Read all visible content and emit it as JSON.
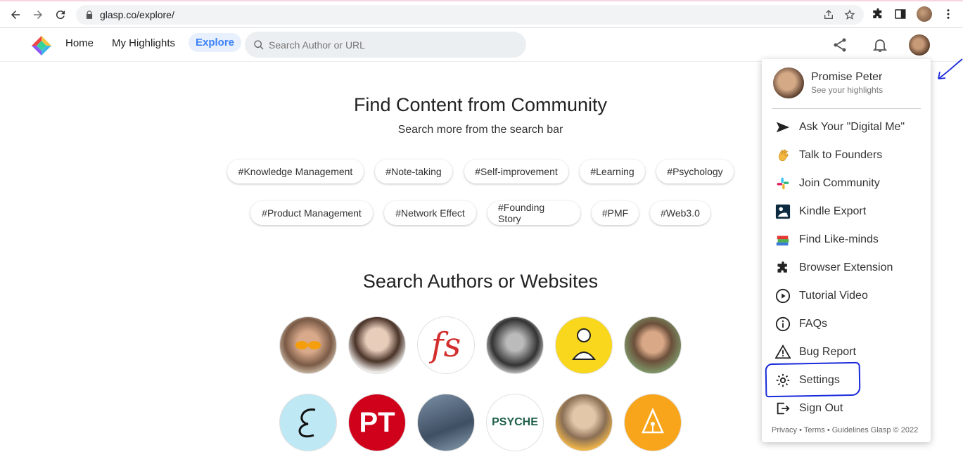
{
  "browser": {
    "url": "glasp.co/explore/"
  },
  "header": {
    "nav": [
      {
        "label": "Home"
      },
      {
        "label": "My Highlights"
      },
      {
        "label": "Explore"
      }
    ],
    "search_placeholder": "Search Author or URL"
  },
  "main": {
    "title": "Find Content from Community",
    "subtitle": "Search more from the search bar",
    "tags_row1": [
      "#Knowledge Management",
      "#Note-taking",
      "#Self-improvement",
      "#Learning",
      "#Psychology"
    ],
    "tags_row2": [
      "#Product Management",
      "#Network Effect",
      "#Founding Story",
      "#PMF",
      "#Web3.0"
    ],
    "authors_title": "Search Authors or Websites",
    "author_texts": [
      "fs",
      "PT",
      "PSYCHE"
    ]
  },
  "dropdown": {
    "name": "Promise Peter",
    "sub": "See your highlights",
    "items": [
      {
        "label": "Ask Your \"Digital Me\"",
        "icon": "send-icon"
      },
      {
        "label": "Talk to Founders",
        "icon": "wave-hand-icon"
      },
      {
        "label": "Join Community",
        "icon": "slack-icon"
      },
      {
        "label": "Kindle Export",
        "icon": "kindle-icon"
      },
      {
        "label": "Find Like-minds",
        "icon": "books-icon"
      },
      {
        "label": "Browser Extension",
        "icon": "puzzle-icon"
      },
      {
        "label": "Tutorial Video",
        "icon": "play-icon"
      },
      {
        "label": "FAQs",
        "icon": "info-icon"
      },
      {
        "label": "Bug Report",
        "icon": "warning-icon"
      },
      {
        "label": "Settings",
        "icon": "gear-icon"
      },
      {
        "label": "Sign Out",
        "icon": "sign-out-icon"
      }
    ],
    "footer": "Privacy • Terms • Guidelines Glasp © 2022"
  },
  "colors": {
    "accent": "#3b82f6",
    "annotation": "#1a2adb"
  }
}
